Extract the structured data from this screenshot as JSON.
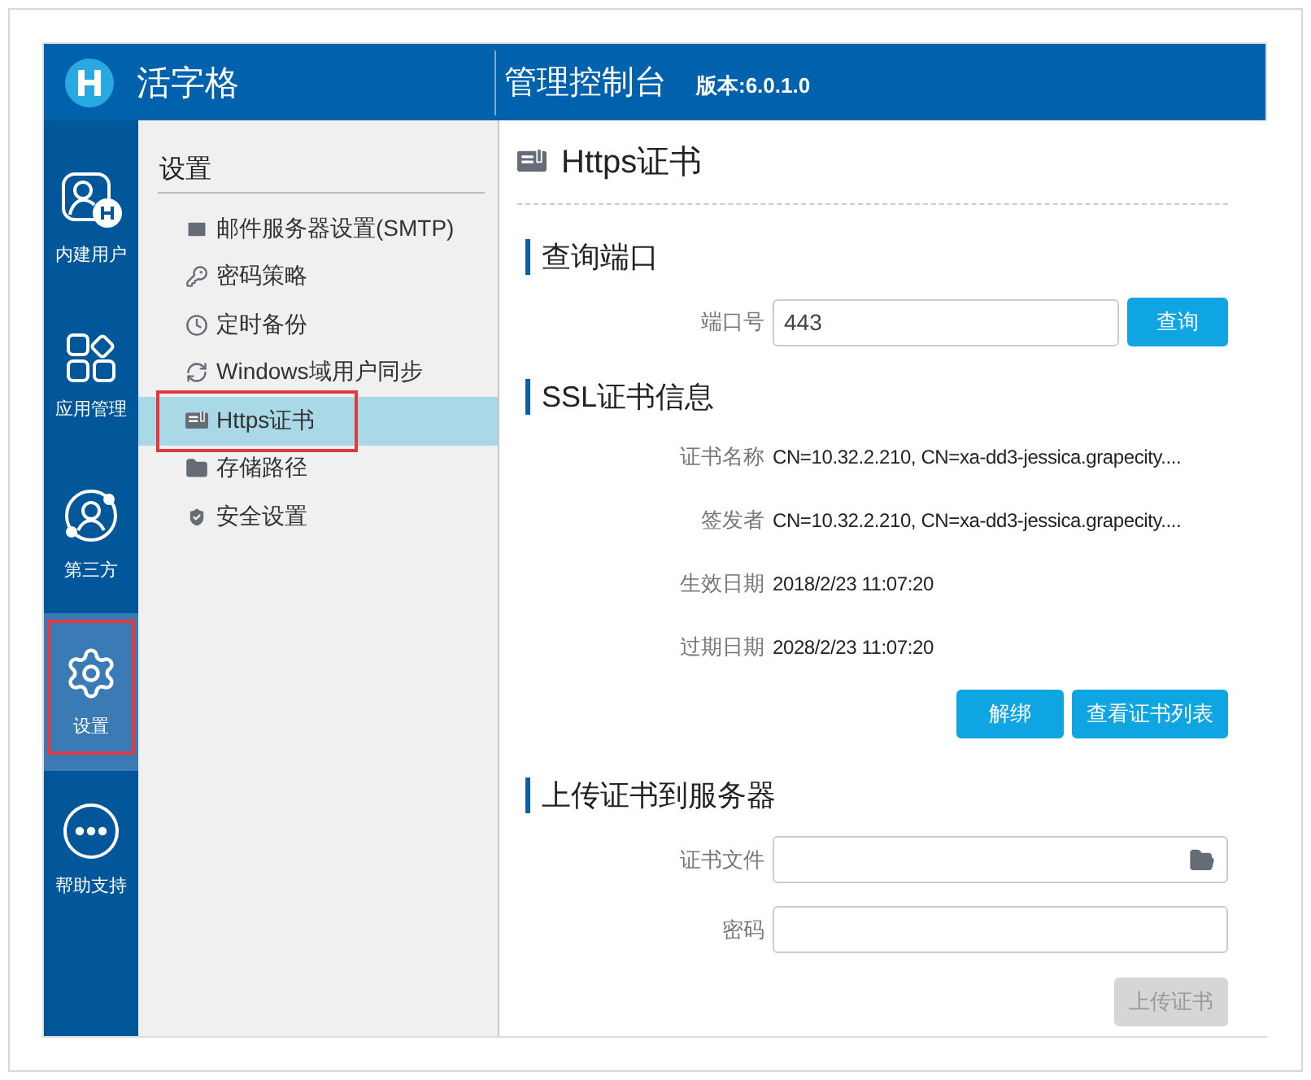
{
  "header": {
    "logo_text": "活字格",
    "title": "管理控制台",
    "version": "版本:6.0.1.0"
  },
  "rail": [
    {
      "label": "内建用户",
      "selected": false,
      "highlighted": false
    },
    {
      "label": "应用管理",
      "selected": false,
      "highlighted": false
    },
    {
      "label": "第三方",
      "selected": false,
      "highlighted": false
    },
    {
      "label": "设置",
      "selected": true,
      "highlighted": true
    },
    {
      "label": "帮助支持",
      "selected": false,
      "highlighted": false
    }
  ],
  "submenu": {
    "title": "设置",
    "items": [
      {
        "label": "邮件服务器设置(SMTP)",
        "selected": false,
        "highlighted": false
      },
      {
        "label": "密码策略",
        "selected": false,
        "highlighted": false
      },
      {
        "label": "定时备份",
        "selected": false,
        "highlighted": false
      },
      {
        "label": "Windows域用户同步",
        "selected": false,
        "highlighted": false
      },
      {
        "label": "Https证书",
        "selected": true,
        "highlighted": true
      },
      {
        "label": "存储路径",
        "selected": false,
        "highlighted": false
      },
      {
        "label": "安全设置",
        "selected": false,
        "highlighted": false
      }
    ]
  },
  "page": {
    "title": "Https证书"
  },
  "query_section": {
    "title": "查询端口",
    "port_label": "端口号",
    "port_value": "443",
    "button": "查询"
  },
  "ssl_section": {
    "title": "SSL证书信息",
    "rows": [
      {
        "label": "证书名称",
        "value": "CN=10.32.2.210, CN=xa-dd3-jessica.grapecity...."
      },
      {
        "label": "签发者",
        "value": "CN=10.32.2.210, CN=xa-dd3-jessica.grapecity...."
      },
      {
        "label": "生效日期",
        "value": "2018/2/23 11:07:20"
      },
      {
        "label": "过期日期",
        "value": "2028/2/23 11:07:20"
      }
    ],
    "buttons": [
      "解绑",
      "查看证书列表"
    ]
  },
  "upload_section": {
    "title": "上传证书到服务器",
    "file_label": "证书文件",
    "password_label": "密码",
    "button": {
      "label": "上传证书",
      "disabled": true
    }
  }
}
